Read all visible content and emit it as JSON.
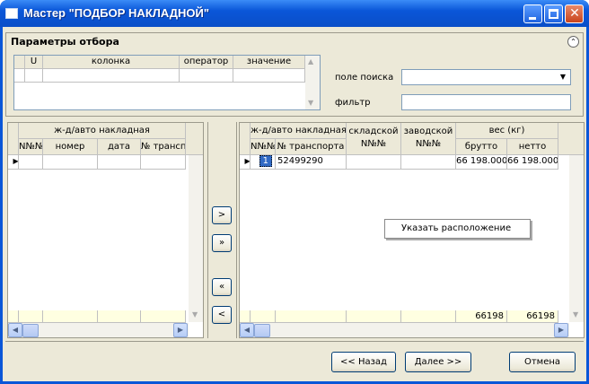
{
  "window": {
    "title": "Мастер \"ПОДБОР НАКЛАДНОЙ\""
  },
  "params": {
    "title": "Параметры отбора",
    "columns": [
      "U",
      "колонка",
      "оператор",
      "значение"
    ],
    "search_field_label": "поле поиска",
    "search_field_value": "",
    "filter_label": "фильтр",
    "filter_value": ""
  },
  "left_grid": {
    "group_header": "ж-д/авто накладная",
    "columns": [
      "N№№",
      "номер",
      "дата",
      "№ трансп"
    ]
  },
  "right_grid": {
    "group_header": "ж-д/авто накладная",
    "col_num": "N№№",
    "col_transport": "№ транспорта",
    "col_warehouse": "складской N№№",
    "col_factory": "заводской N№№",
    "weight_header": "вес (кг)",
    "col_gross": "брутто",
    "col_net": "нетто",
    "row": {
      "num": "1",
      "transport": "52499290",
      "warehouse": "",
      "factory": "",
      "gross": "66 198.000",
      "net": "66 198.000"
    },
    "totals": {
      "gross": "66198",
      "net": "66198"
    }
  },
  "transfer_buttons": {
    "add": ">",
    "add_all": "»",
    "remove_all": "«",
    "remove": "<"
  },
  "context_menu": {
    "item": "Указать расположение"
  },
  "footer": {
    "back": "<< Назад",
    "next": "Далее >>",
    "cancel": "Отмена"
  }
}
